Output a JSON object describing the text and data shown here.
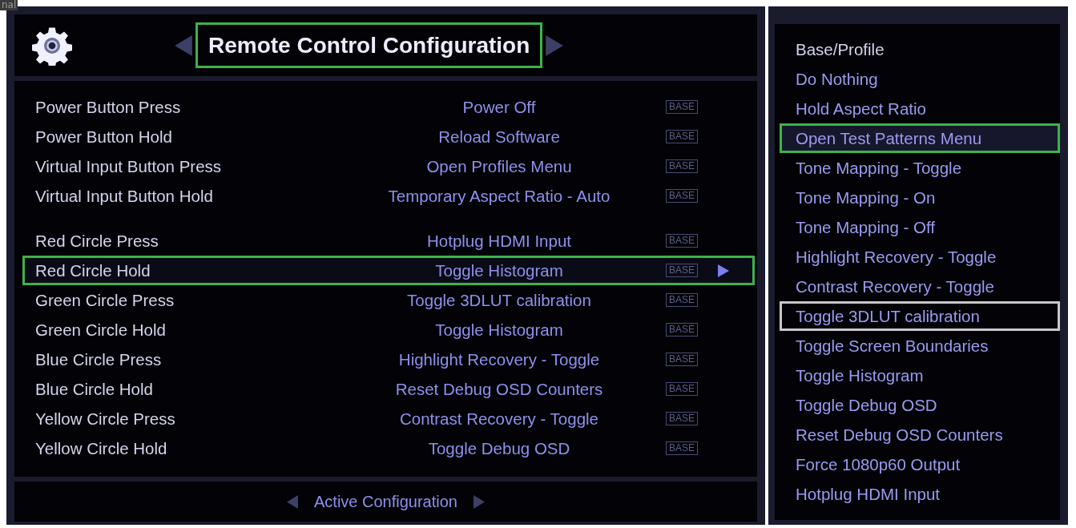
{
  "corner_label": "nal",
  "header": {
    "title": "Remote Control Configuration"
  },
  "groups": [
    {
      "rows": [
        {
          "button": "Power Button Press",
          "action": "Power Off",
          "tag": "BASE",
          "focused": false
        },
        {
          "button": "Power Button Hold",
          "action": "Reload Software",
          "tag": "BASE",
          "focused": false
        },
        {
          "button": "Virtual Input Button Press",
          "action": "Open Profiles Menu",
          "tag": "BASE",
          "focused": false
        },
        {
          "button": "Virtual Input Button Hold",
          "action": "Temporary Aspect Ratio - Auto",
          "tag": "BASE",
          "focused": false
        }
      ]
    },
    {
      "rows": [
        {
          "button": "Red Circle Press",
          "action": "Hotplug HDMI Input",
          "tag": "BASE",
          "focused": false
        },
        {
          "button": "Red Circle Hold",
          "action": "Toggle Histogram",
          "tag": "BASE",
          "focused": true
        },
        {
          "button": "Green Circle Press",
          "action": "Toggle 3DLUT calibration",
          "tag": "BASE",
          "focused": false
        },
        {
          "button": "Green Circle Hold",
          "action": "Toggle Histogram",
          "tag": "BASE",
          "focused": false
        },
        {
          "button": "Blue Circle Press",
          "action": "Highlight Recovery - Toggle",
          "tag": "BASE",
          "focused": false
        },
        {
          "button": "Blue Circle Hold",
          "action": "Reset Debug OSD Counters",
          "tag": "BASE",
          "focused": false
        },
        {
          "button": "Yellow Circle Press",
          "action": "Contrast Recovery - Toggle",
          "tag": "BASE",
          "focused": false
        },
        {
          "button": "Yellow Circle Hold",
          "action": "Toggle Debug OSD",
          "tag": "BASE",
          "focused": false
        }
      ]
    }
  ],
  "footer": {
    "label": "Active Configuration"
  },
  "options": [
    {
      "label": "Base/Profile",
      "selected": false,
      "current": false
    },
    {
      "label": "Do Nothing",
      "selected": false,
      "current": false
    },
    {
      "label": "Hold Aspect Ratio",
      "selected": false,
      "current": false
    },
    {
      "label": "Open Test Patterns Menu",
      "selected": true,
      "current": false
    },
    {
      "label": "Tone Mapping - Toggle",
      "selected": false,
      "current": false
    },
    {
      "label": "Tone Mapping - On",
      "selected": false,
      "current": false
    },
    {
      "label": "Tone Mapping - Off",
      "selected": false,
      "current": false
    },
    {
      "label": "Highlight Recovery - Toggle",
      "selected": false,
      "current": false
    },
    {
      "label": "Contrast Recovery - Toggle",
      "selected": false,
      "current": false
    },
    {
      "label": "Toggle 3DLUT calibration",
      "selected": false,
      "current": true
    },
    {
      "label": "Toggle Screen Boundaries",
      "selected": false,
      "current": false
    },
    {
      "label": "Toggle Histogram",
      "selected": false,
      "current": false
    },
    {
      "label": "Toggle Debug OSD",
      "selected": false,
      "current": false
    },
    {
      "label": "Reset Debug OSD Counters",
      "selected": false,
      "current": false
    },
    {
      "label": "Force 1080p60 Output",
      "selected": false,
      "current": false
    },
    {
      "label": "Hotplug HDMI Input",
      "selected": false,
      "current": false
    }
  ]
}
